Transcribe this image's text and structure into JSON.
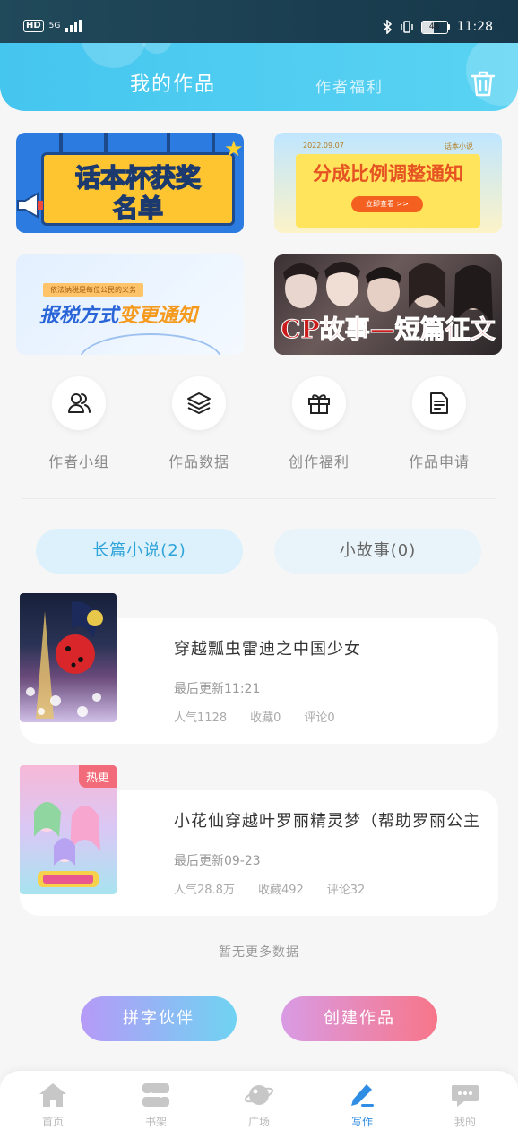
{
  "status_bar": {
    "hd": "HD",
    "network": "5G",
    "battery": "46",
    "battery_level": 0.46,
    "time": "11:28"
  },
  "header": {
    "tab_my_works": "我的作品",
    "tab_author_welfare": "作者福利"
  },
  "banners": [
    {
      "title_line1": "话本杯获奖",
      "title_line2": "名单"
    },
    {
      "date": "2022.09.07",
      "category": "话本小说",
      "title": "分成比例调整通知",
      "button": "立即查看 >>"
    },
    {
      "tag": "依法纳税是每位公民的义务",
      "title_a": "报税方式",
      "title_b": "变更通知"
    },
    {
      "title": "CP故事—短篇征文"
    }
  ],
  "actions": [
    {
      "label": "作者小组",
      "icon": "users-icon"
    },
    {
      "label": "作品数据",
      "icon": "layers-icon"
    },
    {
      "label": "创作福利",
      "icon": "gift-icon"
    },
    {
      "label": "作品申请",
      "icon": "document-icon"
    }
  ],
  "sub_tabs": {
    "novel": "长篇小说(2)",
    "short_story": "小故事(0)"
  },
  "works": [
    {
      "title": "穿越瓢虫雷迪之中国少女",
      "updated": "最后更新11:21",
      "popularity": "人气1128",
      "favorites": "收藏0",
      "comments": "评论0"
    },
    {
      "title": "小花仙穿越叶罗丽精灵梦（帮助罗丽公主",
      "badge": "热更",
      "updated": "最后更新09-23",
      "popularity": "人气28.8万",
      "favorites": "收藏492",
      "comments": "评论32"
    }
  ],
  "no_more": "暂无更多数据",
  "cta": {
    "partner": "拼字伙伴",
    "create": "创建作品"
  },
  "bottom_nav": [
    {
      "label": "首页",
      "icon": "home-icon"
    },
    {
      "label": "书架",
      "icon": "bookshelf-icon"
    },
    {
      "label": "广场",
      "icon": "planet-icon"
    },
    {
      "label": "写作",
      "icon": "pen-icon"
    },
    {
      "label": "我的",
      "icon": "chat-icon"
    }
  ],
  "colors": {
    "header_gradient_start": "#45c6ef",
    "header_gradient_end": "#5ad3f3",
    "accent_blue": "#2fa4da",
    "nav_active": "#2f8de4",
    "hot_badge": "#f26b7a"
  }
}
